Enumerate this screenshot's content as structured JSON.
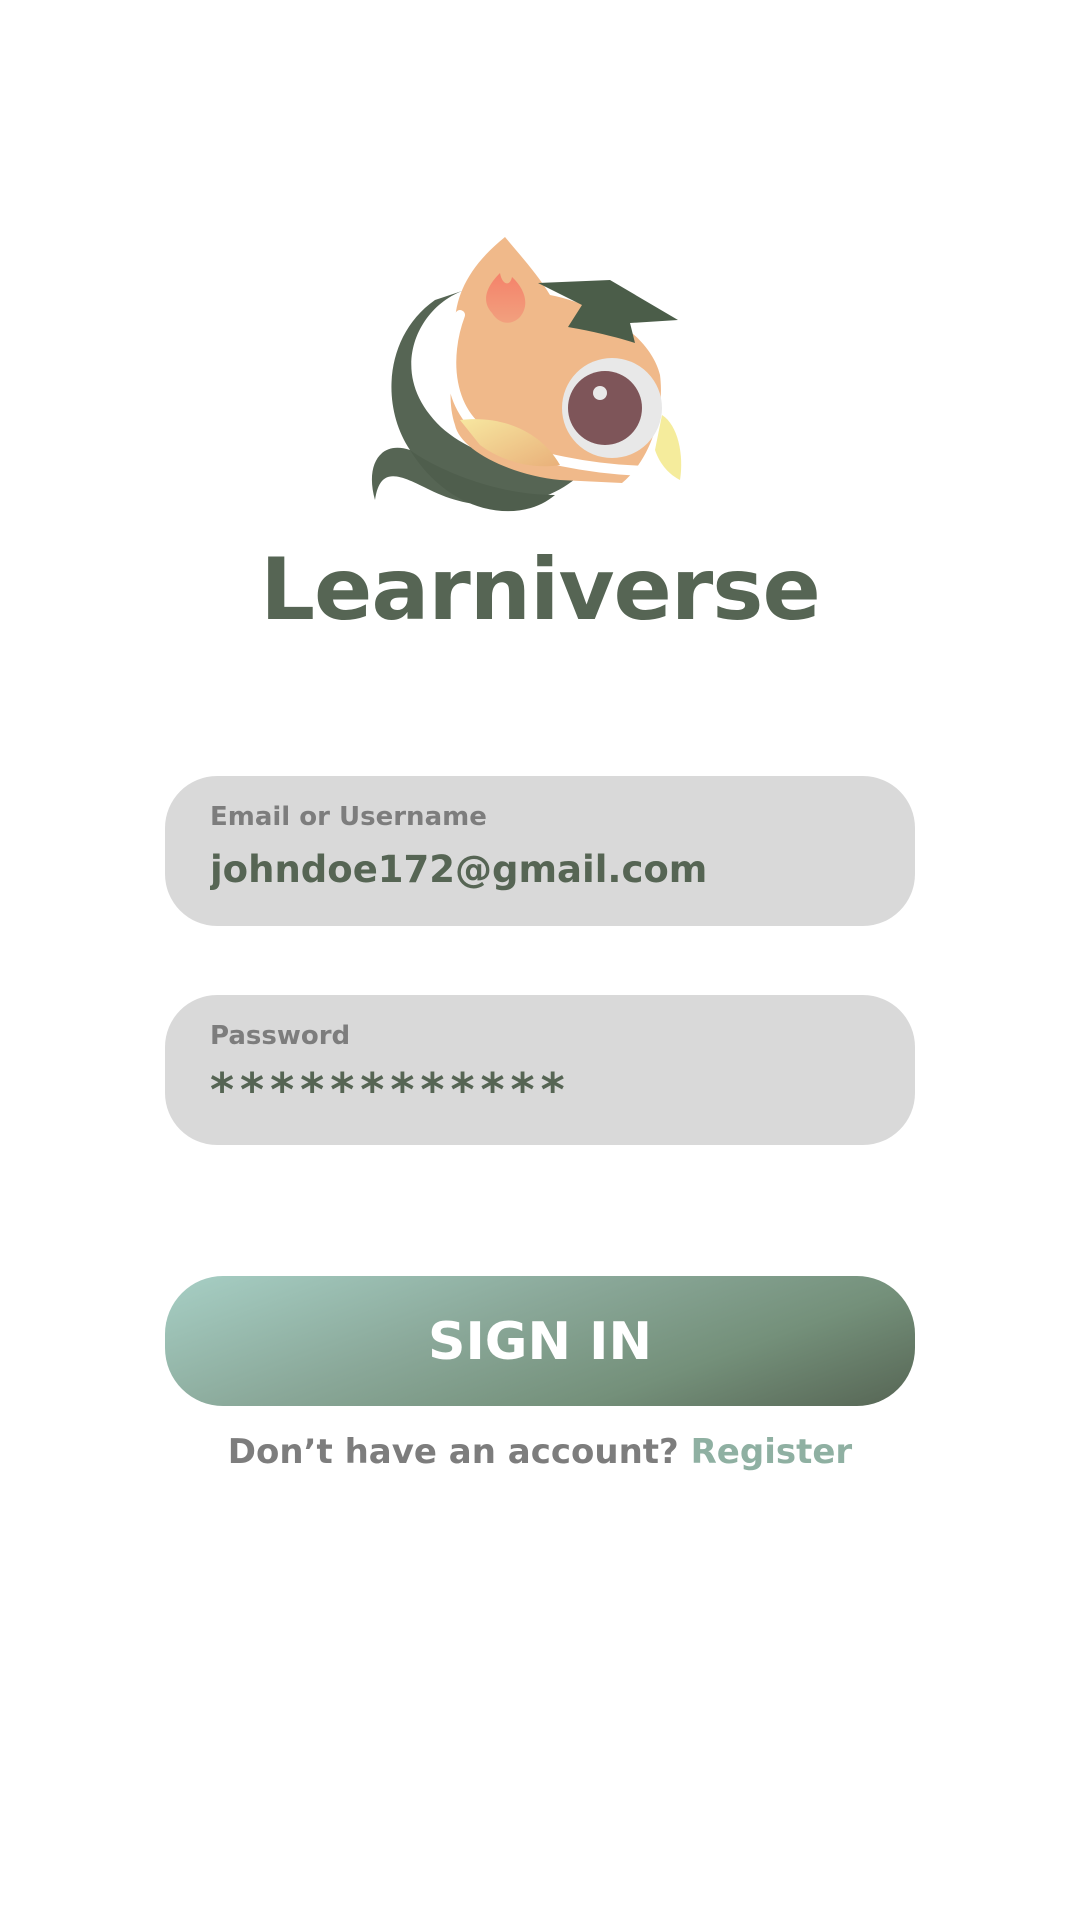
{
  "app": {
    "name": "Learniverse"
  },
  "login": {
    "email_label": "Email or Username",
    "email_value": "johndoe172@gmail.com",
    "password_label": "Password",
    "password_value": "************",
    "signin_label": "SIGN IN",
    "no_account_text": "Don’t have an account?",
    "register_label": "Register"
  },
  "colors": {
    "brand_green": "#566554",
    "field_background": "#d9d9d9",
    "label_gray": "#7d7d7d",
    "register_link": "#8fb0a2",
    "button_gradient_start": "#a7cfc5",
    "button_gradient_end": "#566554"
  },
  "icons": {
    "logo": "owl-graduate-logo-icon"
  }
}
